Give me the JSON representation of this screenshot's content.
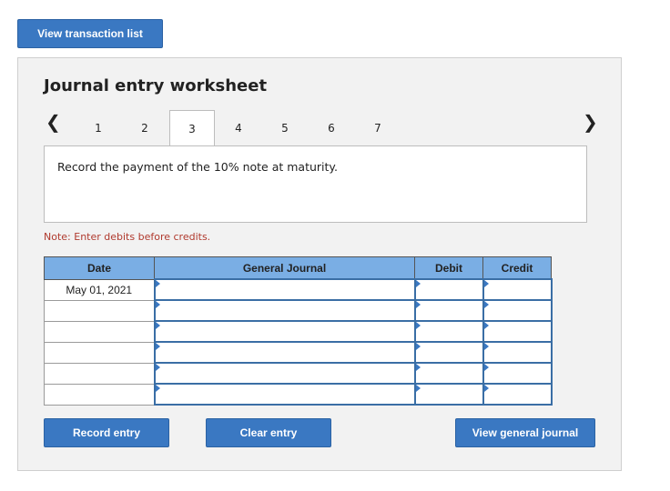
{
  "top_button": "View transaction list",
  "worksheet": {
    "title": "Journal entry worksheet",
    "tabs": [
      "1",
      "2",
      "3",
      "4",
      "5",
      "6",
      "7"
    ],
    "active_tab": "3",
    "instruction": "Record the payment of the 10% note at maturity.",
    "note": "Note: Enter debits before credits."
  },
  "table": {
    "headers": {
      "date": "Date",
      "journal": "General Journal",
      "debit": "Debit",
      "credit": "Credit"
    },
    "rows": [
      {
        "date": "May 01, 2021"
      },
      {
        "date": ""
      },
      {
        "date": ""
      },
      {
        "date": ""
      },
      {
        "date": ""
      },
      {
        "date": ""
      }
    ]
  },
  "buttons": {
    "record": "Record entry",
    "clear": "Clear entry",
    "view_journal": "View general journal"
  },
  "icons": {
    "prev": "chevron-left-icon",
    "next": "chevron-right-icon"
  },
  "colors": {
    "button": "#3a78c2",
    "header": "#7aaee4",
    "note": "#b03a2e"
  }
}
